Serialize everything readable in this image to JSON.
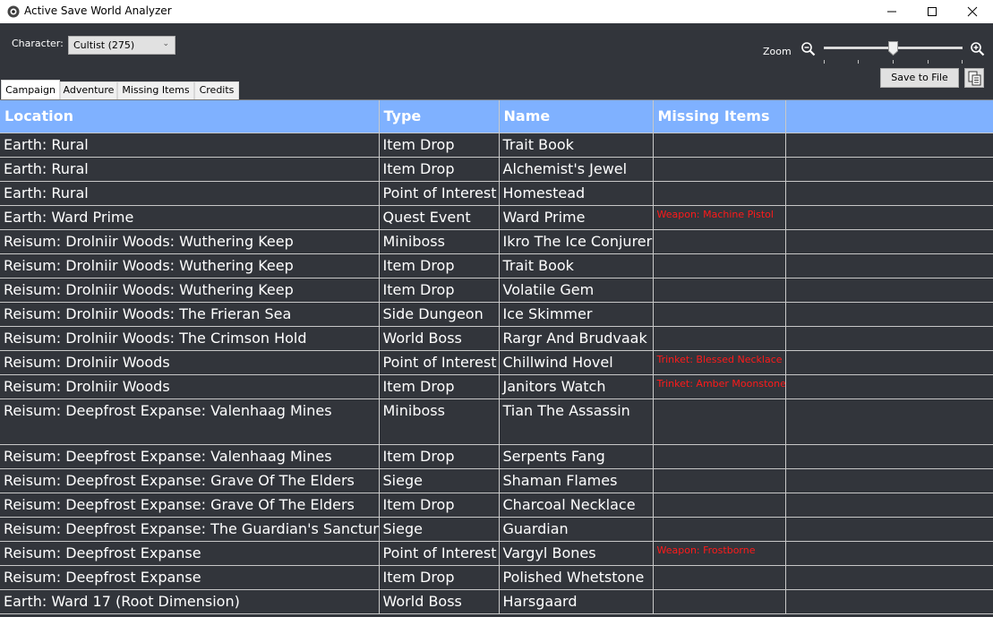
{
  "window": {
    "title": "Active Save World Analyzer"
  },
  "toolbar": {
    "character_label": "Character:",
    "character_value": "Cultist (275)",
    "zoom_label": "Zoom",
    "zoom_level": 0.5,
    "save_label": "Save to File"
  },
  "tabs": [
    {
      "label": "Campaign",
      "active": true
    },
    {
      "label": "Adventure"
    },
    {
      "label": "Missing Items"
    },
    {
      "label": "Credits"
    }
  ],
  "table": {
    "headers": [
      "Location",
      "Type",
      "Name",
      "Missing Items"
    ],
    "rows": [
      [
        "Earth: Rural",
        "Item Drop",
        "Trait Book",
        ""
      ],
      [
        "Earth: Rural",
        "Item Drop",
        "Alchemist's Jewel",
        ""
      ],
      [
        "Earth: Rural",
        "Point of Interest",
        "Homestead",
        ""
      ],
      [
        "Earth: Ward Prime",
        "Quest Event",
        "Ward Prime",
        "Weapon: Machine Pistol"
      ],
      [
        "Reisum: Drolniir Woods: Wuthering Keep",
        "Miniboss",
        "Ikro The Ice Conjurer",
        ""
      ],
      [
        "Reisum: Drolniir Woods: Wuthering Keep",
        "Item Drop",
        "Trait Book",
        ""
      ],
      [
        "Reisum: Drolniir Woods: Wuthering Keep",
        "Item Drop",
        "Volatile Gem",
        ""
      ],
      [
        "Reisum: Drolniir Woods: The Frieran Sea",
        "Side Dungeon",
        "Ice Skimmer",
        ""
      ],
      [
        "Reisum: Drolniir Woods: The Crimson Hold",
        "World Boss",
        "Rargr And Brudvaak",
        ""
      ],
      [
        "Reisum: Drolniir Woods",
        "Point of Interest",
        "Chillwind Hovel",
        "Trinket: Blessed Necklace"
      ],
      [
        "Reisum: Drolniir Woods",
        "Item Drop",
        "Janitors Watch",
        "Trinket: Amber Moonstone"
      ],
      [
        "Reisum: Deepfrost Expanse: Valenhaag Mines",
        "Miniboss",
        "Tian The Assassin",
        ""
      ],
      [
        "Reisum: Deepfrost Expanse: Valenhaag Mines",
        "Item Drop",
        "Serpents Fang",
        ""
      ],
      [
        "Reisum: Deepfrost Expanse: Grave Of The Elders",
        "Siege",
        "Shaman Flames",
        ""
      ],
      [
        "Reisum: Deepfrost Expanse: Grave Of The Elders",
        "Item Drop",
        "Charcoal Necklace",
        ""
      ],
      [
        "Reisum: Deepfrost Expanse: The Guardian's Sanctum",
        "Siege",
        "Guardian",
        ""
      ],
      [
        "Reisum: Deepfrost Expanse",
        "Point of Interest",
        "Vargyl Bones",
        "Weapon: Frostborne"
      ],
      [
        "Reisum: Deepfrost Expanse",
        "Item Drop",
        "Polished Whetstone",
        ""
      ],
      [
        "Earth: Ward 17 (Root Dimension)",
        "World Boss",
        "Harsgaard",
        ""
      ]
    ]
  },
  "colors": {
    "background": "#32353b",
    "header": "#7fb1ff",
    "missing_text": "#ff1a1a"
  }
}
